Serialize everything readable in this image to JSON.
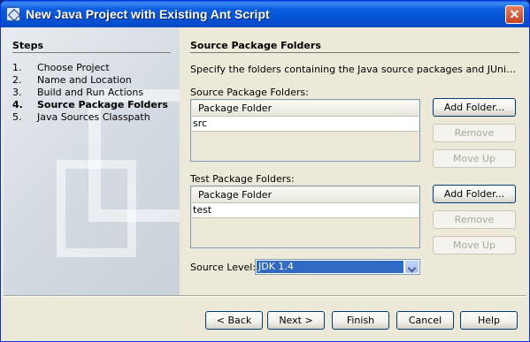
{
  "window": {
    "title": "New Java Project with Existing Ant Script",
    "close_glyph": "✕"
  },
  "steps": {
    "title": "Steps",
    "items": [
      {
        "num": "1.",
        "label": "Choose Project"
      },
      {
        "num": "2.",
        "label": "Name and Location"
      },
      {
        "num": "3.",
        "label": "Build and Run Actions"
      },
      {
        "num": "4.",
        "label": "Source Package Folders"
      },
      {
        "num": "5.",
        "label": "Java Sources Classpath"
      }
    ],
    "active_index": 3
  },
  "panel": {
    "title": "Source Package Folders",
    "description": "Specify the folders containing the Java source packages and JUnit test pa...",
    "source": {
      "label": "Source Package Folders:",
      "column_header": "Package Folder",
      "rows": [
        "src"
      ],
      "add_button": "Add Folder...",
      "remove_button": "Remove",
      "move_up_button": "Move Up"
    },
    "test": {
      "label": "Test Package Folders:",
      "column_header": "Package Folder",
      "rows": [
        "test"
      ],
      "add_button": "Add Folder...",
      "remove_button": "Remove",
      "move_up_button": "Move Up"
    },
    "source_level": {
      "label": "Source Level:",
      "value": "JDK 1.4"
    }
  },
  "buttons": {
    "back": "< Back",
    "next": "Next >",
    "finish": "Finish",
    "cancel": "Cancel",
    "help": "Help"
  },
  "colors": {
    "title_bar": "#0a5ee0",
    "dialog_bg": "#ece9d8",
    "selection": "#316ac5",
    "close_button": "#c8421e"
  }
}
